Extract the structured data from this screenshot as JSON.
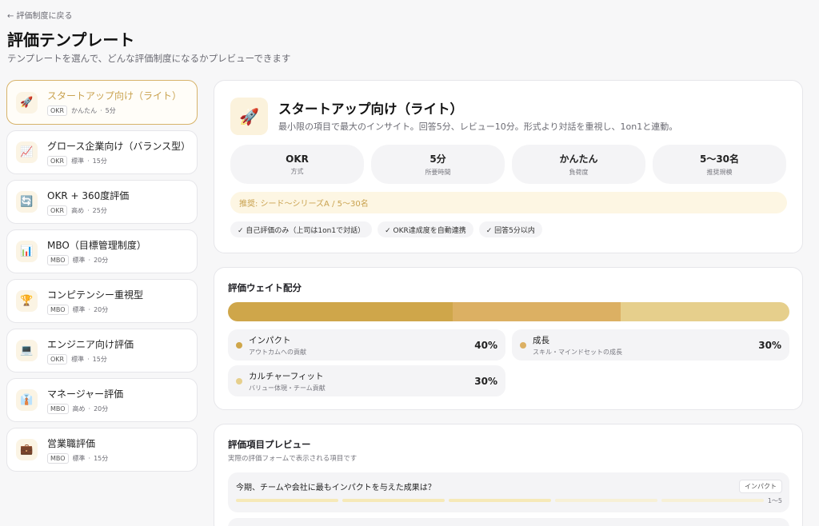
{
  "nav": {
    "back_label": "← 評価制度に戻る"
  },
  "header": {
    "title": "評価テンプレート",
    "subtitle": "テンプレートを選んで、どんな評価制度になるかプレビューできます"
  },
  "templates": [
    {
      "icon": "🚀",
      "icon_name": "rocket-icon",
      "name": "スタートアップ向け（ライト）",
      "method": "OKR",
      "load": "かんたん",
      "time": "5分",
      "active": true
    },
    {
      "icon": "📈",
      "icon_name": "chart-increasing-icon",
      "name": "グロース企業向け（バランス型）",
      "method": "OKR",
      "load": "標準",
      "time": "15分",
      "active": false
    },
    {
      "icon": "🔄",
      "icon_name": "cycle-arrows-icon",
      "name": "OKR + 360度評価",
      "method": "OKR",
      "load": "高め",
      "time": "25分",
      "active": false
    },
    {
      "icon": "📊",
      "icon_name": "bar-chart-icon",
      "name": "MBO（目標管理制度）",
      "method": "MBO",
      "load": "標準",
      "time": "20分",
      "active": false
    },
    {
      "icon": "🏆",
      "icon_name": "trophy-icon",
      "name": "コンピテンシー重視型",
      "method": "MBO",
      "load": "標準",
      "time": "20分",
      "active": false
    },
    {
      "icon": "💻",
      "icon_name": "laptop-icon",
      "name": "エンジニア向け評価",
      "method": "OKR",
      "load": "標準",
      "time": "15分",
      "active": false
    },
    {
      "icon": "👔",
      "icon_name": "necktie-icon",
      "name": "マネージャー評価",
      "method": "MBO",
      "load": "高め",
      "time": "20分",
      "active": false
    },
    {
      "icon": "💼",
      "icon_name": "briefcase-icon",
      "name": "営業職評価",
      "method": "MBO",
      "load": "標準",
      "time": "15分",
      "active": false
    }
  ],
  "detail": {
    "icon": "🚀",
    "icon_name": "rocket-icon",
    "title": "スタートアップ向け（ライト）",
    "description": "最小限の項目で最大のインサイト。回答5分、レビュー10分。形式より対話を重視し、1on1と連動。",
    "stats": [
      {
        "value": "OKR",
        "label": "方式"
      },
      {
        "value": "5分",
        "label": "所要時間"
      },
      {
        "value": "かんたん",
        "label": "負荷度"
      },
      {
        "value": "5〜30名",
        "label": "推奨規模"
      }
    ],
    "recommendation": "推奨: シード〜シリーズA / 5〜30名",
    "chips": [
      "✓ 自己評価のみ（上司は1on1で対話）",
      "✓ OKR達成度を自動連携",
      "✓ 回答5分以内"
    ]
  },
  "weights": {
    "title": "評価ウェイト配分",
    "items": [
      {
        "name": "インパクト",
        "desc": "アウトカムへの貢献",
        "percent": 40,
        "percent_label": "40%",
        "color": "#cfa64a"
      },
      {
        "name": "成長",
        "desc": "スキル・マインドセットの成長",
        "percent": 30,
        "percent_label": "30%",
        "color": "#dcb063"
      },
      {
        "name": "カルチャーフィット",
        "desc": "バリュー体現・チーム貢献",
        "percent": 30,
        "percent_label": "30%",
        "color": "#e6cf8c"
      }
    ]
  },
  "preview": {
    "title": "評価項目プレビュー",
    "subtitle": "実際の評価フォームで表示される項目です",
    "question": "今期、チームや会社に最もインパクトを与えた成果は？",
    "badge": "インパクト",
    "scale": "1〜5"
  }
}
